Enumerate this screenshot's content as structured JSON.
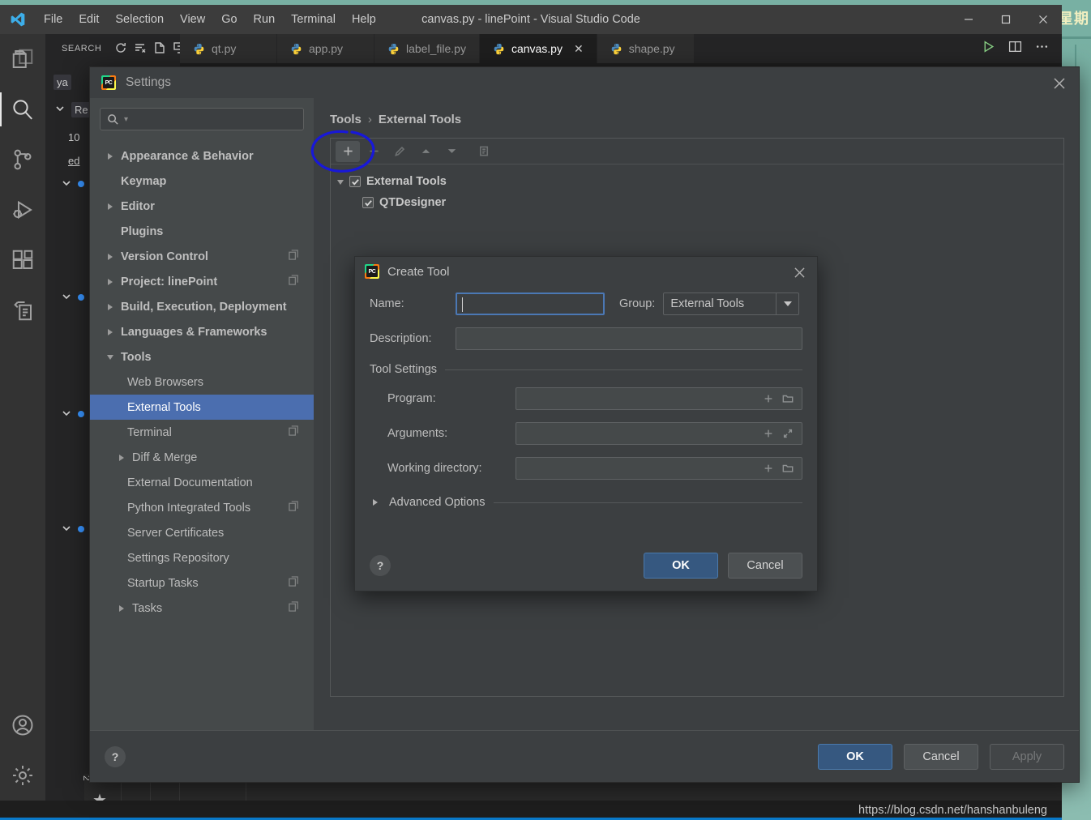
{
  "desktop": {
    "clock_text": "星期"
  },
  "vscode": {
    "title": "canvas.py - linePoint - Visual Studio Code",
    "menu": [
      "File",
      "Edit",
      "Selection",
      "View",
      "Go",
      "Run",
      "Terminal",
      "Help"
    ],
    "window_controls": {
      "minimize": "minimize-icon",
      "maximize": "maximize-icon",
      "close": "close-icon"
    },
    "activity_bar": [
      {
        "name": "explorer-icon",
        "active": false
      },
      {
        "name": "search-icon",
        "active": true
      },
      {
        "name": "source-control-icon",
        "active": false
      },
      {
        "name": "run-debug-icon",
        "active": false
      },
      {
        "name": "extensions-icon",
        "active": false
      },
      {
        "name": "remote-explorer-icon",
        "active": false
      },
      {
        "name": "accounts-icon",
        "active": false
      },
      {
        "name": "manage-settings-icon",
        "active": false
      }
    ],
    "sidebar": {
      "title": "SEARCH",
      "actions": [
        "refresh-icon",
        "clear-search-results-icon",
        "open-new-search-editor-icon",
        "collapse-all-icon"
      ],
      "fragments": [
        "ya",
        "Re",
        "10",
        "ed"
      ]
    },
    "tabs": [
      {
        "label": "qt.py",
        "active": false
      },
      {
        "label": "app.py",
        "active": false
      },
      {
        "label": "label_file.py",
        "active": false
      },
      {
        "label": "canvas.py",
        "active": true
      },
      {
        "label": "shape.py",
        "active": false
      }
    ],
    "tab_actions": [
      "run-python-file-icon",
      "split-editor-icon",
      "more-actions-icon"
    ],
    "watermark": "https://blog.csdn.net/hanshanbuleng"
  },
  "settings": {
    "title": "Settings",
    "search_placeholder": "",
    "tree": [
      {
        "label": "Appearance & Behavior",
        "twisty": "collapsed",
        "indent": 0,
        "bold": true,
        "copy": false
      },
      {
        "label": "Keymap",
        "twisty": "none",
        "indent": 0,
        "bold": true,
        "copy": false
      },
      {
        "label": "Editor",
        "twisty": "collapsed",
        "indent": 0,
        "bold": true,
        "copy": false
      },
      {
        "label": "Plugins",
        "twisty": "none",
        "indent": 0,
        "bold": true,
        "copy": false
      },
      {
        "label": "Version Control",
        "twisty": "collapsed",
        "indent": 0,
        "bold": true,
        "copy": true
      },
      {
        "label": "Project: linePoint",
        "twisty": "collapsed",
        "indent": 0,
        "bold": true,
        "copy": true
      },
      {
        "label": "Build, Execution, Deployment",
        "twisty": "collapsed",
        "indent": 0,
        "bold": true,
        "copy": false
      },
      {
        "label": "Languages & Frameworks",
        "twisty": "collapsed",
        "indent": 0,
        "bold": true,
        "copy": false
      },
      {
        "label": "Tools",
        "twisty": "expanded",
        "indent": 0,
        "bold": true,
        "copy": false
      },
      {
        "label": "Web Browsers",
        "twisty": "none",
        "indent": 1,
        "bold": false,
        "copy": false
      },
      {
        "label": "External Tools",
        "twisty": "none",
        "indent": 1,
        "bold": false,
        "copy": false,
        "selected": true
      },
      {
        "label": "Terminal",
        "twisty": "none",
        "indent": 1,
        "bold": false,
        "copy": true
      },
      {
        "label": "Diff & Merge",
        "twisty": "collapsed",
        "indent": 1,
        "bold": false,
        "copy": false
      },
      {
        "label": "External Documentation",
        "twisty": "none",
        "indent": 1,
        "bold": false,
        "copy": false
      },
      {
        "label": "Python Integrated Tools",
        "twisty": "none",
        "indent": 1,
        "bold": false,
        "copy": true
      },
      {
        "label": "Server Certificates",
        "twisty": "none",
        "indent": 1,
        "bold": false,
        "copy": false
      },
      {
        "label": "Settings Repository",
        "twisty": "none",
        "indent": 1,
        "bold": false,
        "copy": false
      },
      {
        "label": "Startup Tasks",
        "twisty": "none",
        "indent": 1,
        "bold": false,
        "copy": true
      },
      {
        "label": "Tasks",
        "twisty": "collapsed",
        "indent": 1,
        "bold": false,
        "copy": true
      }
    ],
    "breadcrumb": {
      "parent": "Tools",
      "separator": "›",
      "current": "External Tools"
    },
    "toolbar": [
      {
        "name": "add-tool-button",
        "glyph": "plus",
        "enabled": true,
        "highlighted": true
      },
      {
        "name": "remove-tool-button",
        "glyph": "minus",
        "enabled": false
      },
      {
        "name": "edit-tool-button",
        "glyph": "pencil",
        "enabled": false
      },
      {
        "name": "move-up-button",
        "glyph": "up",
        "enabled": false
      },
      {
        "name": "move-down-button",
        "glyph": "down",
        "enabled": false
      },
      {
        "name": "copy-tool-button",
        "glyph": "copy",
        "enabled": false
      }
    ],
    "tools_tree": [
      {
        "label": "External Tools",
        "checked": true,
        "indent": 0,
        "expanded": true
      },
      {
        "label": "QTDesigner",
        "checked": true,
        "indent": 1,
        "expanded": false
      }
    ],
    "help_glyph": "?",
    "buttons": {
      "ok": "OK",
      "cancel": "Cancel",
      "apply": "Apply"
    }
  },
  "create_tool": {
    "title": "Create Tool",
    "name_label": "Name:",
    "name_value": "",
    "group_label": "Group:",
    "group_value": "External Tools",
    "description_label": "Description:",
    "description_value": "",
    "tool_settings_label": "Tool Settings",
    "fields": [
      {
        "label": "Program:",
        "value": "",
        "actions": [
          "insert-macro-icon",
          "browse-folder-icon"
        ]
      },
      {
        "label": "Arguments:",
        "value": "",
        "actions": [
          "insert-macro-icon",
          "expand-editor-icon"
        ]
      },
      {
        "label": "Working directory:",
        "value": "",
        "actions": [
          "insert-macro-icon",
          "browse-folder-icon"
        ]
      }
    ],
    "advanced_options_label": "Advanced Options",
    "help_glyph": "?",
    "buttons": {
      "ok": "OK",
      "cancel": "Cancel"
    }
  },
  "annotation": {
    "shape": "hand-drawn-ellipse",
    "color": "#1818d8"
  },
  "colors": {
    "accent_blue": "#4b6eaf",
    "primary_button": "#365880",
    "panel_bg": "#3c3f41",
    "sidebar_bg": "#45494a",
    "desktop": "#7cb3a6",
    "status_bar": "#0a7aca"
  }
}
